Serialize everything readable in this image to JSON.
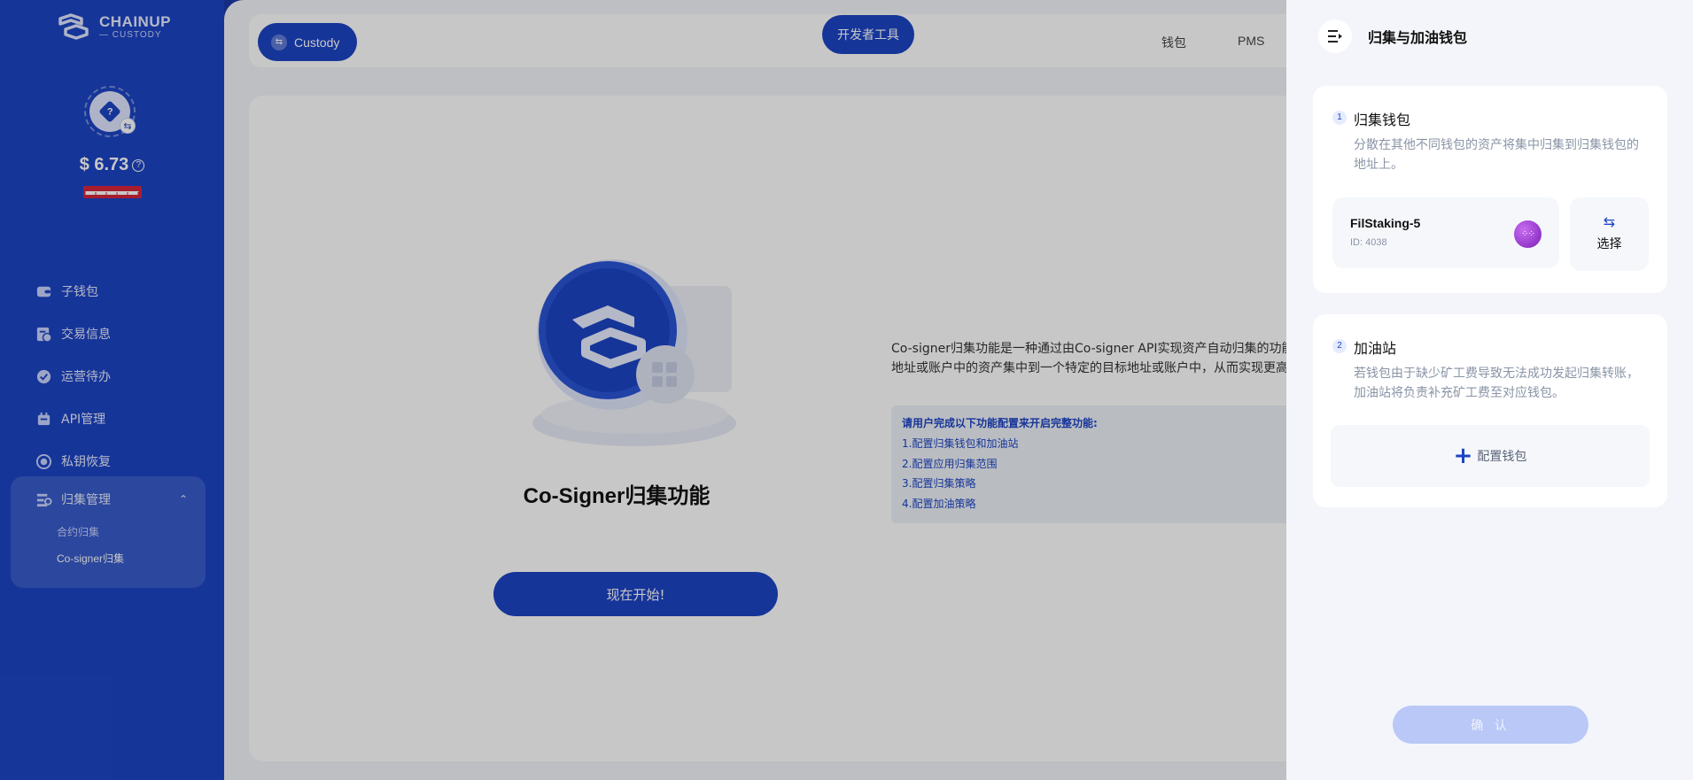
{
  "sidebar": {
    "logo": {
      "main": "CHAINUP",
      "sub": "— CUSTODY"
    },
    "balance": "$ 6.73",
    "balance_sub": "▬▬▬▬▬",
    "menu": [
      {
        "label": "子钱包"
      },
      {
        "label": "交易信息"
      },
      {
        "label": "运营待办"
      },
      {
        "label": "API管理"
      },
      {
        "label": "私钥恢复"
      }
    ],
    "group": {
      "label": "归集管理",
      "children": [
        {
          "label": "合约归集"
        },
        {
          "label": "Co-signer归集"
        }
      ]
    }
  },
  "topbar": {
    "custody_label": "Custody",
    "dev_tools_label": "开发者工具",
    "links": [
      "钱包",
      "PMS"
    ]
  },
  "main": {
    "title": "Co-Signer归集功能",
    "start_button": "现在开始!",
    "description_line1": "Co-signer归集功能是一种通过由Co-signer API实现资产自动归集的功能。",
    "description_line2": "地址或账户中的资产集中到一个特定的目标地址或账户中，从而实现更高",
    "steps_title": "请用户完成以下功能配置来开启完整功能:",
    "steps": [
      "1.配置归集钱包和加油站",
      "2.配置应用归集范围",
      "3.配置归集策略",
      "4.配置加油策略"
    ]
  },
  "drawer": {
    "title": "归集与加油钱包",
    "collect": {
      "step": "1",
      "title": "归集钱包",
      "description": "分散在其他不同钱包的资产将集中归集到归集钱包的地址上。",
      "wallet_name": "FilStaking-5",
      "wallet_id": "ID: 4038",
      "select_label": "选择"
    },
    "gas": {
      "step": "2",
      "title": "加油站",
      "description": "若钱包由于缺少矿工费导致无法成功发起归集转账，加油站将负责补充矿工费至对应钱包。",
      "config_label": "配置钱包"
    },
    "confirm_label": "确 认"
  },
  "colors": {
    "primary": "#1d45c4",
    "drawer_bg": "#f3f5fa",
    "confirm_disabled": "#b9c8f7"
  }
}
